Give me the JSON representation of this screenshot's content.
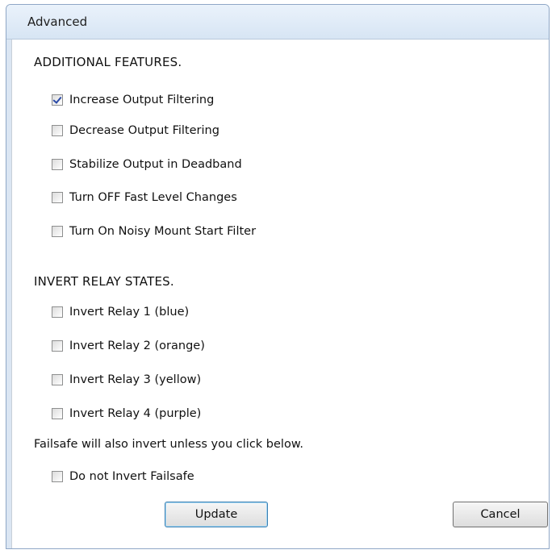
{
  "window": {
    "title": "Advanced"
  },
  "sections": {
    "additional_features_heading": "ADDITIONAL FEATURES.",
    "invert_relay_heading": "INVERT RELAY STATES."
  },
  "features": [
    {
      "label": "Increase Output Filtering",
      "checked": true
    },
    {
      "label": "Decrease Output Filtering",
      "checked": false
    },
    {
      "label": "Stabilize Output in Deadband",
      "checked": false
    },
    {
      "label": "Turn OFF Fast Level Changes",
      "checked": false
    },
    {
      "label": "Turn On Noisy Mount Start Filter",
      "checked": false
    }
  ],
  "relays": [
    {
      "label": "Invert Relay 1 (blue)",
      "checked": false
    },
    {
      "label": "Invert Relay 2 (orange)",
      "checked": false
    },
    {
      "label": "Invert Relay 3 (yellow)",
      "checked": false
    },
    {
      "label": "Invert Relay 4 (purple)",
      "checked": false
    }
  ],
  "failsafe": {
    "note": "Failsafe will also invert unless you click below.",
    "label": "Do not Invert Failsafe",
    "checked": false
  },
  "buttons": {
    "update": "Update",
    "cancel": "Cancel"
  }
}
